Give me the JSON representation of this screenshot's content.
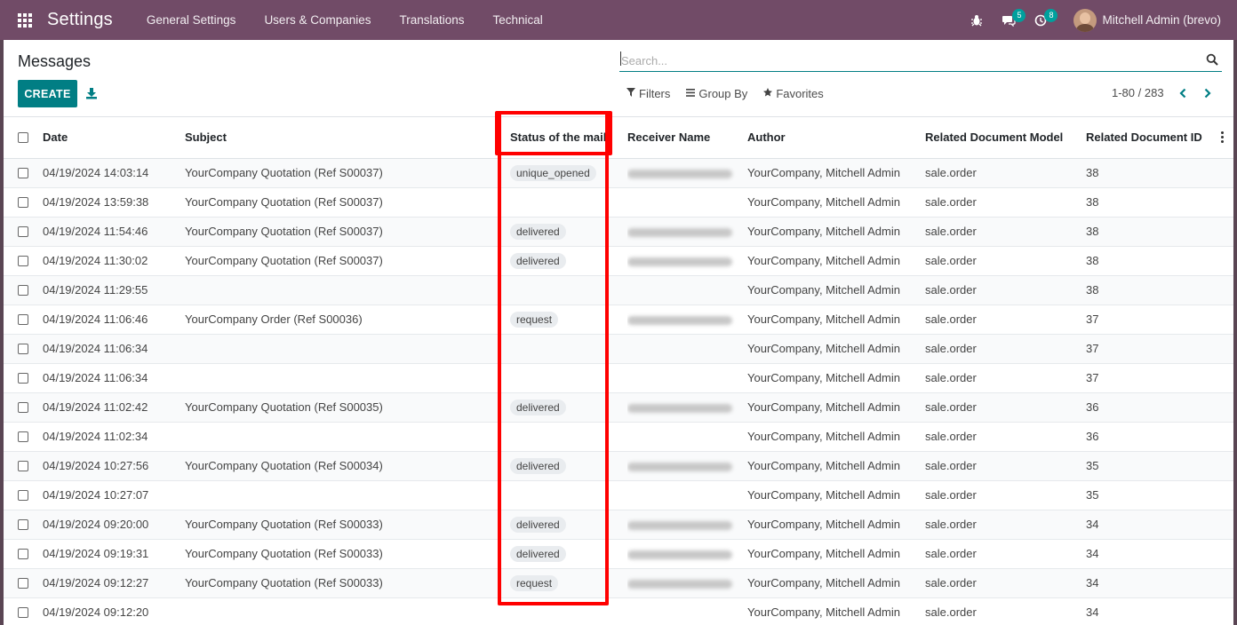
{
  "navbar": {
    "app_name": "Settings",
    "menu": [
      "General Settings",
      "Users & Companies",
      "Translations",
      "Technical"
    ],
    "messages_count": "5",
    "activities_count": "8",
    "user": "Mitchell Admin (brevo)"
  },
  "control_panel": {
    "title": "Messages",
    "create_label": "CREATE",
    "search_placeholder": "Search...",
    "filters_label": "Filters",
    "groupby_label": "Group By",
    "favorites_label": "Favorites",
    "pager": "1-80 / 283"
  },
  "table": {
    "columns": [
      "Date",
      "Subject",
      "Status of the mail",
      "Receiver Name",
      "Author",
      "Related Document Model",
      "Related Document ID"
    ],
    "rows": [
      {
        "date": "04/19/2024 14:03:14",
        "subject": "YourCompany Quotation (Ref S00037)",
        "status": "unique_opened",
        "receiver": true,
        "author": "YourCompany, Mitchell Admin",
        "model": "sale.order",
        "id": "38"
      },
      {
        "date": "04/19/2024 13:59:38",
        "subject": "YourCompany Quotation (Ref S00037)",
        "status": "",
        "receiver": false,
        "author": "YourCompany, Mitchell Admin",
        "model": "sale.order",
        "id": "38"
      },
      {
        "date": "04/19/2024 11:54:46",
        "subject": "YourCompany Quotation (Ref S00037)",
        "status": "delivered",
        "receiver": true,
        "author": "YourCompany, Mitchell Admin",
        "model": "sale.order",
        "id": "38"
      },
      {
        "date": "04/19/2024 11:30:02",
        "subject": "YourCompany Quotation (Ref S00037)",
        "status": "delivered",
        "receiver": true,
        "author": "YourCompany, Mitchell Admin",
        "model": "sale.order",
        "id": "38"
      },
      {
        "date": "04/19/2024 11:29:55",
        "subject": "",
        "status": "",
        "receiver": false,
        "author": "YourCompany, Mitchell Admin",
        "model": "sale.order",
        "id": "38"
      },
      {
        "date": "04/19/2024 11:06:46",
        "subject": "YourCompany Order (Ref S00036)",
        "status": "request",
        "receiver": true,
        "author": "YourCompany, Mitchell Admin",
        "model": "sale.order",
        "id": "37"
      },
      {
        "date": "04/19/2024 11:06:34",
        "subject": "",
        "status": "",
        "receiver": false,
        "author": "YourCompany, Mitchell Admin",
        "model": "sale.order",
        "id": "37"
      },
      {
        "date": "04/19/2024 11:06:34",
        "subject": "",
        "status": "",
        "receiver": false,
        "author": "YourCompany, Mitchell Admin",
        "model": "sale.order",
        "id": "37"
      },
      {
        "date": "04/19/2024 11:02:42",
        "subject": "YourCompany Quotation (Ref S00035)",
        "status": "delivered",
        "receiver": true,
        "author": "YourCompany, Mitchell Admin",
        "model": "sale.order",
        "id": "36"
      },
      {
        "date": "04/19/2024 11:02:34",
        "subject": "",
        "status": "",
        "receiver": false,
        "author": "YourCompany, Mitchell Admin",
        "model": "sale.order",
        "id": "36"
      },
      {
        "date": "04/19/2024 10:27:56",
        "subject": "YourCompany Quotation (Ref S00034)",
        "status": "delivered",
        "receiver": true,
        "author": "YourCompany, Mitchell Admin",
        "model": "sale.order",
        "id": "35"
      },
      {
        "date": "04/19/2024 10:27:07",
        "subject": "",
        "status": "",
        "receiver": false,
        "author": "YourCompany, Mitchell Admin",
        "model": "sale.order",
        "id": "35"
      },
      {
        "date": "04/19/2024 09:20:00",
        "subject": "YourCompany Quotation (Ref S00033)",
        "status": "delivered",
        "receiver": true,
        "author": "YourCompany, Mitchell Admin",
        "model": "sale.order",
        "id": "34"
      },
      {
        "date": "04/19/2024 09:19:31",
        "subject": "YourCompany Quotation (Ref S00033)",
        "status": "delivered",
        "receiver": true,
        "author": "YourCompany, Mitchell Admin",
        "model": "sale.order",
        "id": "34"
      },
      {
        "date": "04/19/2024 09:12:27",
        "subject": "YourCompany Quotation (Ref S00033)",
        "status": "request",
        "receiver": true,
        "author": "YourCompany, Mitchell Admin",
        "model": "sale.order",
        "id": "34"
      },
      {
        "date": "04/19/2024 09:12:20",
        "subject": "",
        "status": "",
        "receiver": false,
        "author": "YourCompany, Mitchell Admin",
        "model": "sale.order",
        "id": "34"
      }
    ]
  },
  "colors": {
    "navbar": "#714b67",
    "primary": "#017e84",
    "highlight": "#ff0000",
    "badge": "#00a09d"
  }
}
